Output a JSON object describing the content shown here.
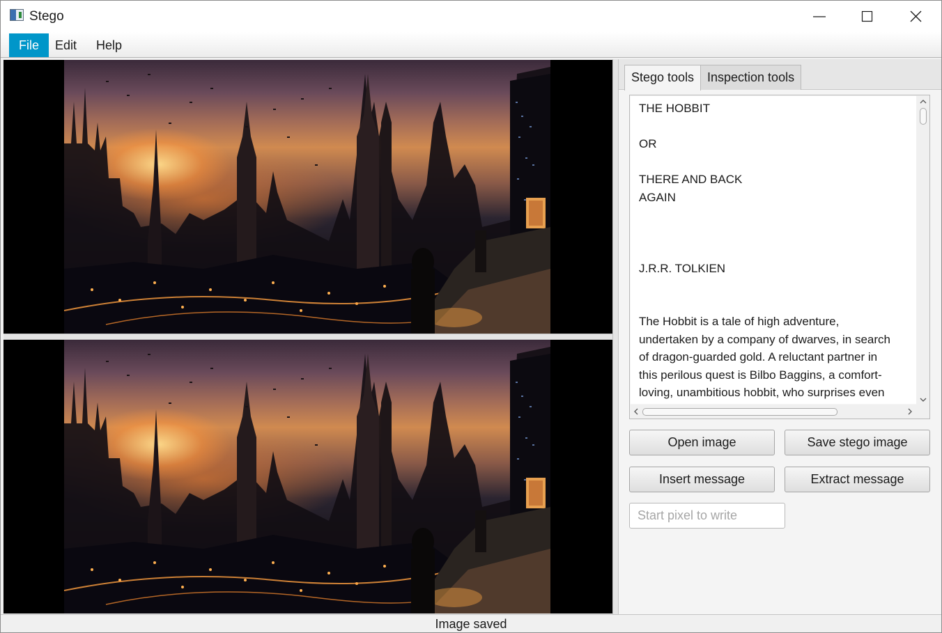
{
  "window": {
    "title": "Stego"
  },
  "menu": {
    "items": [
      "File",
      "Edit",
      "Help"
    ],
    "active": "File"
  },
  "tabs": [
    "Stego tools",
    "Inspection tools"
  ],
  "message": {
    "lines": [
      "THE HOBBIT",
      "",
      "OR",
      "",
      "THERE AND BACK",
      "AGAIN",
      "",
      "",
      "",
      "J.R.R. TOLKIEN",
      "",
      "",
      "The Hobbit is a tale of high adventure,",
      "undertaken by a company of dwarves, in search",
      "of dragon-guarded gold. A reluctant partner in",
      "this perilous quest is Bilbo Baggins, a comfort-",
      "loving, unambitious hobbit, who surprises even"
    ]
  },
  "buttons": {
    "open_image": "Open image",
    "save_stego_image": "Save stego image",
    "insert_message": "Insert message",
    "extract_message": "Extract message"
  },
  "start_pixel": {
    "placeholder": "Start pixel to write",
    "value": ""
  },
  "status": {
    "text": "Image saved"
  },
  "colors": {
    "menu_active": "#0096c9",
    "window_bg": "#f0f0f0"
  }
}
